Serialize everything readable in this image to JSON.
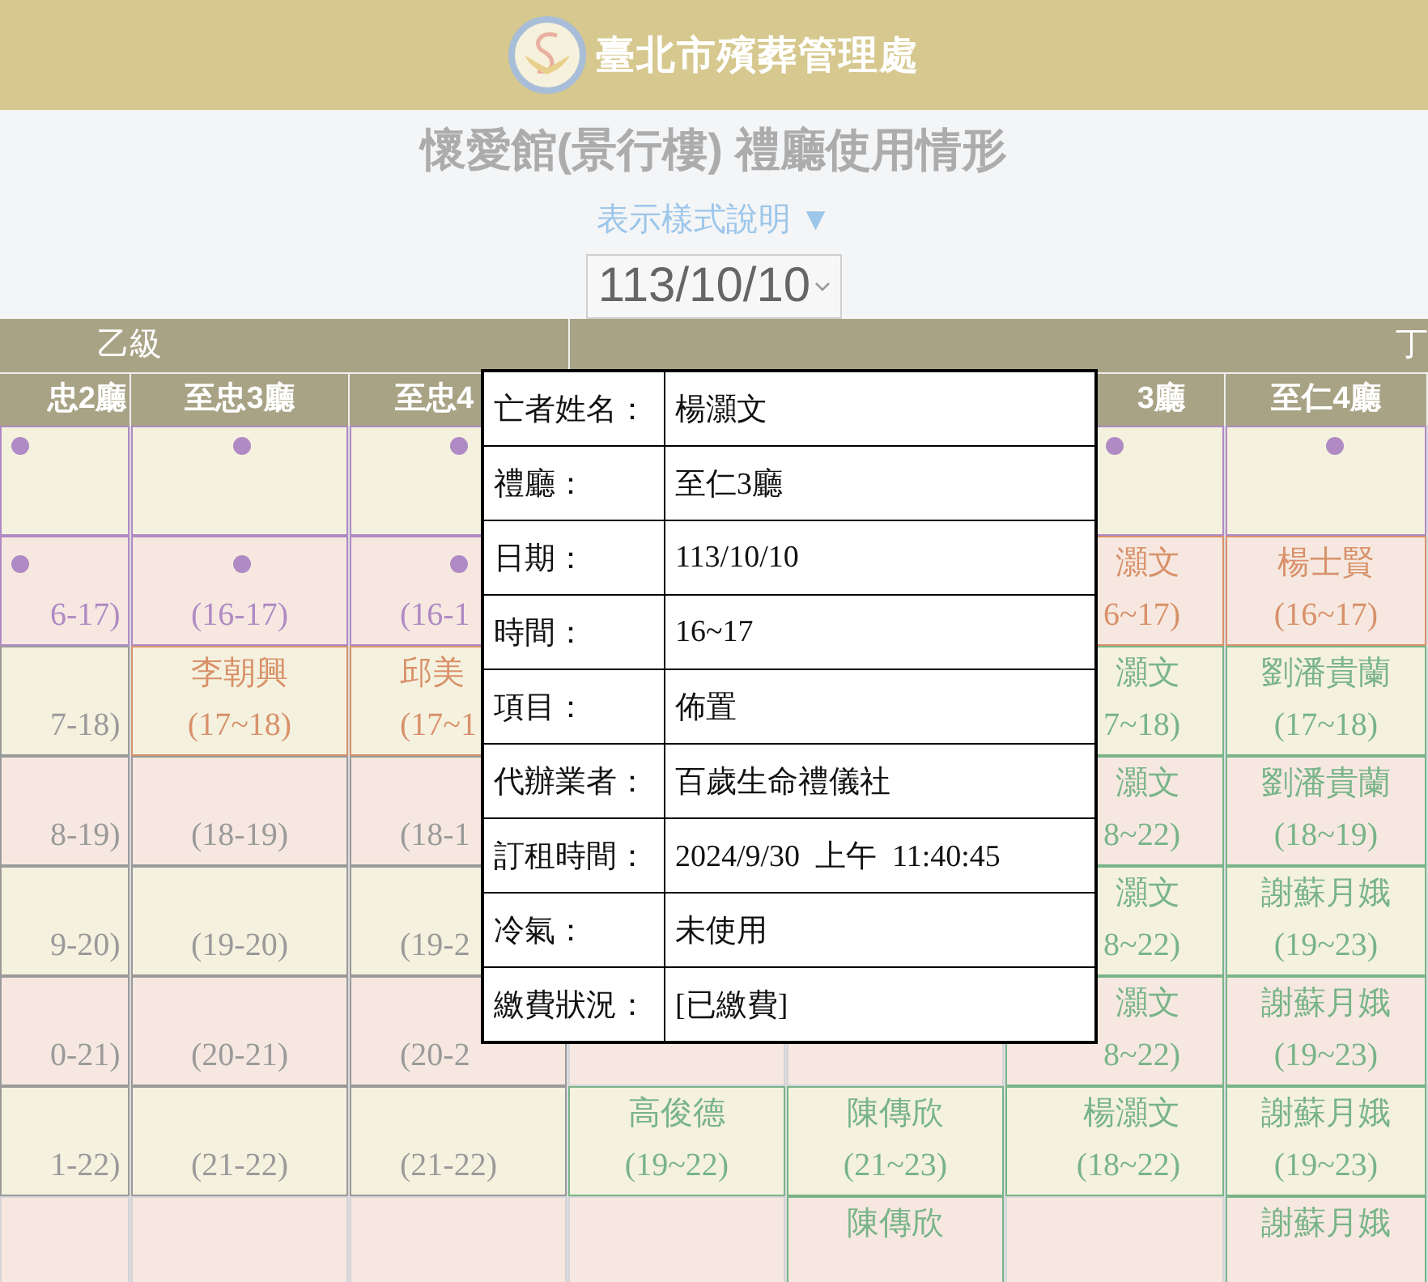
{
  "header": {
    "org_name": "臺北市殯葬管理處"
  },
  "title": "懷愛館(景行樓) 禮廳使用情形",
  "legend_link": "表示樣式說明 ▼",
  "date_select": {
    "value": "113/10/10"
  },
  "groups": [
    {
      "label": "乙級"
    },
    {
      "label": "丁"
    }
  ],
  "halls": [
    {
      "label": "忠2廳"
    },
    {
      "label": "至忠3廳"
    },
    {
      "label": "至忠4"
    },
    {
      "label": "3廳"
    },
    {
      "label": "至仁4廳"
    }
  ],
  "rows": [
    {
      "cells": [
        {
          "dot": true,
          "color": "#b08ac4"
        },
        {
          "dot": true,
          "color": "#b08ac4"
        },
        {
          "dot": true,
          "color": "#b08ac4"
        },
        {},
        {},
        {
          "dot": true,
          "color": "#b08ac4"
        },
        {
          "dot": true,
          "color": "#b08ac4"
        }
      ]
    },
    {
      "cells": [
        {
          "dot": true,
          "time": "6-17)",
          "color": "#b08ac4"
        },
        {
          "dot": true,
          "time": "(16-17)",
          "color": "#b08ac4"
        },
        {
          "dot": true,
          "time": "(16-1",
          "color": "#b08ac4"
        },
        {},
        {},
        {
          "dot": false,
          "name": "灝文",
          "time": "6~17)",
          "color": "#d8916a"
        },
        {
          "dot": false,
          "name": "楊士賢",
          "time": "(16~17)",
          "color": "#d8916a"
        }
      ]
    },
    {
      "cells": [
        {
          "dot": false,
          "time": "7-18)",
          "color": "#9a9a9a"
        },
        {
          "dot": false,
          "name": "李朝興",
          "time": "(17~18)",
          "color": "#d8916a"
        },
        {
          "dot": false,
          "name": "邱美",
          "time": "(17~1",
          "color": "#d8916a"
        },
        {},
        {},
        {
          "dot": false,
          "name": "灝文",
          "time": "7~18)",
          "color": "#78b488"
        },
        {
          "dot": false,
          "name": "劉潘貴蘭",
          "time": "(17~18)",
          "color": "#78b488"
        }
      ]
    },
    {
      "cells": [
        {
          "dot": false,
          "time": "8-19)",
          "color": "#9a9a9a"
        },
        {
          "dot": false,
          "time": "(18-19)",
          "color": "#9a9a9a"
        },
        {
          "dot": false,
          "time": "(18-1",
          "color": "#9a9a9a"
        },
        {},
        {},
        {
          "dot": false,
          "name": "灝文",
          "time": "8~22)",
          "color": "#78b488"
        },
        {
          "dot": false,
          "name": "劉潘貴蘭",
          "time": "(18~19)",
          "color": "#78b488"
        }
      ]
    },
    {
      "cells": [
        {
          "dot": false,
          "time": "9-20)",
          "color": "#9a9a9a"
        },
        {
          "dot": false,
          "time": "(19-20)",
          "color": "#9a9a9a"
        },
        {
          "dot": false,
          "time": "(19-2",
          "color": "#9a9a9a"
        },
        {},
        {},
        {
          "dot": false,
          "name": "灝文",
          "time": "8~22)",
          "color": "#78b488"
        },
        {
          "dot": false,
          "name": "謝蘇月娥",
          "time": "(19~23)",
          "color": "#78b488"
        }
      ]
    },
    {
      "cells": [
        {
          "dot": false,
          "time": "0-21)",
          "color": "#9a9a9a"
        },
        {
          "dot": false,
          "time": "(20-21)",
          "color": "#9a9a9a"
        },
        {
          "dot": false,
          "time": "(20-2",
          "color": "#9a9a9a"
        },
        {
          "kind": "empty"
        },
        {
          "kind": "empty"
        },
        {
          "dot": false,
          "name": "灝文",
          "time": "8~22)",
          "color": "#78b488"
        },
        {
          "dot": false,
          "name": "謝蘇月娥",
          "time": "(19~23)",
          "color": "#78b488"
        }
      ]
    },
    {
      "cells": [
        {
          "dot": false,
          "time": "1-22)",
          "color": "#9a9a9a"
        },
        {
          "dot": false,
          "time": "(21-22)",
          "color": "#9a9a9a"
        },
        {
          "dot": false,
          "time": "(21-22)",
          "color": "#9a9a9a"
        },
        {
          "dot": false,
          "name": "高俊德",
          "time": "(19~22)",
          "color": "#78b488"
        },
        {
          "dot": false,
          "name": "陳傳欣",
          "time": "(21~23)",
          "color": "#78b488"
        },
        {
          "dot": false,
          "name": "楊灝文",
          "time": "(18~22)",
          "color": "#78b488"
        },
        {
          "dot": false,
          "name": "謝蘇月娥",
          "time": "(19~23)",
          "color": "#78b488"
        }
      ]
    },
    {
      "cells": [
        {
          "kind": "empty"
        },
        {
          "kind": "empty"
        },
        {
          "kind": "empty"
        },
        {
          "kind": "empty"
        },
        {
          "dot": false,
          "name": "陳傳欣",
          "color": "#78b488"
        },
        {
          "kind": "empty"
        },
        {
          "dot": false,
          "name": "謝蘇月娥",
          "color": "#78b488"
        }
      ]
    }
  ],
  "popup": {
    "rows": [
      {
        "label": "亡者姓名：",
        "value": "楊灝文"
      },
      {
        "label": "禮廳：",
        "value": "至仁3廳"
      },
      {
        "label": "日期：",
        "value": "113/10/10"
      },
      {
        "label": "時間：",
        "value": "16~17"
      },
      {
        "label": "項目：",
        "value": "佈置"
      },
      {
        "label": "代辦業者：",
        "value": "百歲生命禮儀社"
      },
      {
        "label": "訂租時間：",
        "value": "2024/9/30  上午  11:40:45"
      },
      {
        "label": "冷氣：",
        "value": "未使用"
      },
      {
        "label": "繳費狀況：",
        "value": "[已繳費]"
      }
    ]
  }
}
